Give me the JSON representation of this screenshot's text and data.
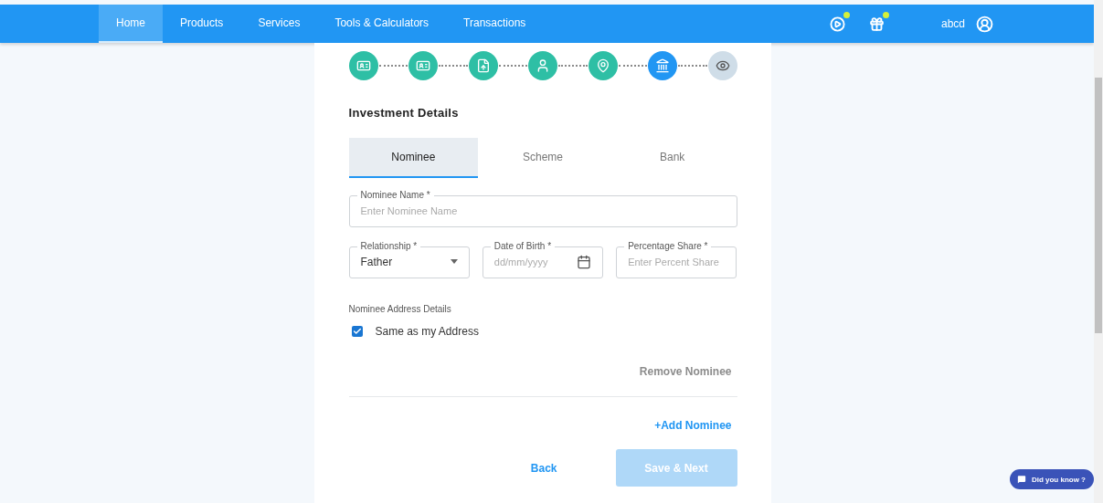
{
  "nav": {
    "items": [
      {
        "label": "Home",
        "selected": true
      },
      {
        "label": "Products",
        "selected": false
      },
      {
        "label": "Services",
        "selected": false
      },
      {
        "label": "Tools & Calculators",
        "selected": false
      },
      {
        "label": "Transactions",
        "selected": false
      }
    ],
    "user": "abcd"
  },
  "steps": [
    {
      "completed": true,
      "selected": false
    },
    {
      "completed": true,
      "selected": false
    },
    {
      "completed": true,
      "selected": false
    },
    {
      "completed": true,
      "selected": false
    },
    {
      "completed": true,
      "selected": false
    },
    {
      "completed": false,
      "selected": true
    },
    {
      "completed": false,
      "selected": false
    }
  ],
  "heading": "Investment Details",
  "tabs": [
    {
      "label": "Nominee",
      "selected": true
    },
    {
      "label": "Scheme",
      "selected": false
    },
    {
      "label": "Bank",
      "selected": false
    }
  ],
  "fields": [
    {
      "kind": "text",
      "label": "Nominee Name *",
      "placeholder": "Enter Nominee Name"
    },
    {
      "kind": "select",
      "label": "Relationship *",
      "value": "Father"
    },
    {
      "kind": "date",
      "label": "Date of Birth *",
      "placeholder": "dd/mm/yyyy"
    },
    {
      "kind": "text",
      "label": "Percentage Share *",
      "placeholder": "Enter Percent Share"
    }
  ],
  "address_section": {
    "title": "Nominee Address Details",
    "checkbox": {
      "label": "Same as my Address",
      "checked": true
    }
  },
  "remove_link": "Remove Nominee",
  "add_link": "+Add Nominee",
  "back_button": "Back",
  "save_button": {
    "label": "Save & Next",
    "disabled": true
  },
  "help_button": "Did you know ?"
}
